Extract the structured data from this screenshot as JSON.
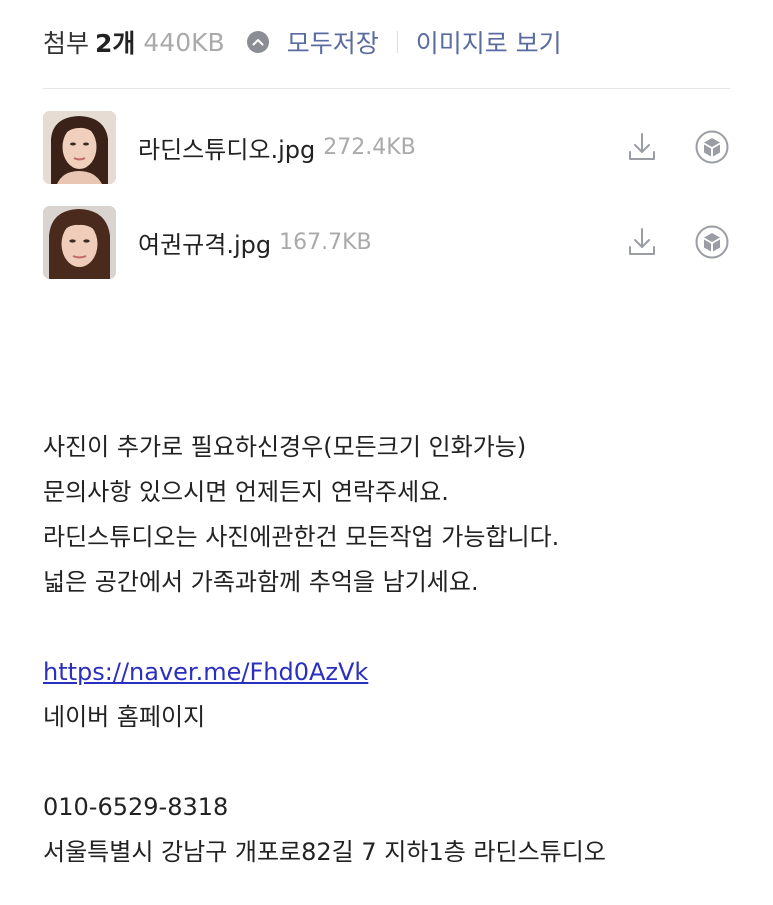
{
  "attachments": {
    "label": "첨부",
    "count": "2개",
    "total_size": "440KB",
    "save_all": "모두저장",
    "view_as_images": "이미지로 보기",
    "files": [
      {
        "name": "라딘스튜디오.jpg",
        "size": "272.4KB",
        "thumb_icon": "portrait-thumbnail"
      },
      {
        "name": "여권규격.jpg",
        "size": "167.7KB",
        "thumb_icon": "portrait-thumbnail"
      }
    ],
    "actions": {
      "download_icon": "download-icon",
      "save_icon": "cube-icon"
    }
  },
  "message": {
    "lines": [
      "사진이 추가로 필요하신경우(모든크기 인화가능)",
      "문의사항 있으시면 언제든지 연락주세요.",
      "라딘스튜디오는 사진에관한건 모든작업 가능합니다.",
      "넓은 공간에서 가족과함께 추억을 남기세요."
    ],
    "link": "https://naver.me/Fhd0AzVk",
    "link_caption": "네이버 홈페이지",
    "phone": "010-6529-8318",
    "address": "서울특별시 강남구 개포로82길 7 지하1층 라딘스튜디오"
  },
  "colors": {
    "link_accent": "#5a6b9e",
    "hyperlink": "#2b2fbf",
    "muted": "#aaaaaa"
  }
}
